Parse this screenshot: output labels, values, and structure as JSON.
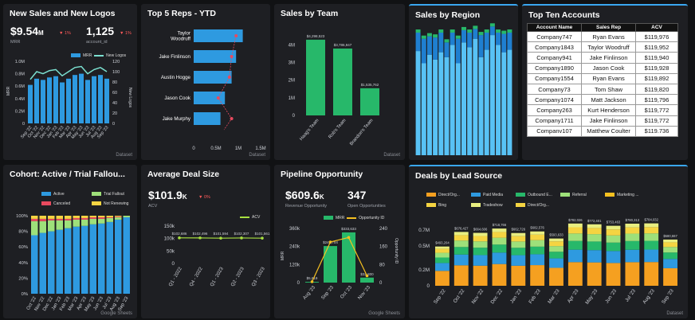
{
  "panels": {
    "new_sales": {
      "title": "New Sales and New Logos",
      "kpi1": "$9.54",
      "kpi1_unit": "M",
      "kpi1_delta": "▼ 1%",
      "kpi1_sub": "MRR",
      "kpi2": "1,125",
      "kpi2_delta": "▼ 1%",
      "kpi2_sub": "account_id",
      "legend": [
        "MRR",
        "New Logos"
      ],
      "source": "Dataset"
    },
    "top_reps": {
      "title": "Top 5 Reps - YTD",
      "source": "Dataset"
    },
    "sales_team": {
      "title": "Sales by Team",
      "source": "Dataset"
    },
    "sales_region": {
      "title": "Sales by Region"
    },
    "top_accounts": {
      "title": "Top Ten Accounts",
      "headers": [
        "Account Name",
        "Sales Rep",
        "ACV"
      ],
      "rows": [
        [
          "Company747",
          "Ryan Evans",
          "$119,976"
        ],
        [
          "Company1843",
          "Taylor Woodruff",
          "$119,952"
        ],
        [
          "Company941",
          "Jake Finlinson",
          "$119,940"
        ],
        [
          "Company1890",
          "Jason Cook",
          "$119,928"
        ],
        [
          "Company1554",
          "Ryan Evans",
          "$119,892"
        ],
        [
          "Company73",
          "Tom Shaw",
          "$119,820"
        ],
        [
          "Company1074",
          "Matt Jackson",
          "$119,796"
        ],
        [
          "Company263",
          "Kurt Henderson",
          "$119,772"
        ],
        [
          "Company1711",
          "Jake Finlinson",
          "$119,772"
        ],
        [
          "Companv107",
          "Matthew Coulter",
          "$119.736"
        ]
      ]
    },
    "cohort": {
      "title": "Cohort: Active / Trial Fallou...",
      "legend": [
        "Active",
        "Trial Fallout",
        "Canceled",
        "Not Renewing"
      ],
      "source": "Google Sheets"
    },
    "deal_size": {
      "title": "Average Deal Size",
      "kpi": "$101.9",
      "kpi_unit": "K",
      "kpi_delta": "▼ 0%",
      "kpi_sub": "ACV",
      "legend": [
        "ACV"
      ]
    },
    "pipeline": {
      "title": "Pipeline Opportunity",
      "kpi1": "$609.6",
      "kpi1_unit": "K",
      "kpi1_sub": "Revenue Opportunity",
      "kpi2": "347",
      "kpi2_sub": "Open Opportunities",
      "legend": [
        "MRR",
        "Opportunity ID"
      ],
      "source": "Google Sheets"
    },
    "lead_source": {
      "title": "Deals by Lead Source",
      "legend": [
        "Direct/Org...",
        "Paid Media",
        "Outbound E...",
        "Referral",
        "Marketing ...",
        "Bing",
        "Tradeshow",
        "Direct/Org..."
      ],
      "source": "Dataset"
    }
  },
  "colors": {
    "blue": "#2e9ae0",
    "lightblue": "#58c2f5",
    "green": "#27b86a",
    "lightgreen": "#9ee07a",
    "yellow": "#f5d442",
    "orange": "#f5a020",
    "red": "#e84a5f",
    "lime": "#a8e040"
  },
  "chart_data": [
    {
      "type": "bar",
      "id": "new_sales",
      "categories": [
        "Sep '22",
        "Oct '22",
        "Nov '22",
        "Dec '22",
        "Jan '23",
        "Feb '23",
        "Mar '23",
        "Apr '23",
        "May '23",
        "Jun '23",
        "Jul '23",
        "Aug '23",
        "Sep '23"
      ],
      "series": [
        {
          "name": "MRR",
          "values": [
            0.62,
            0.72,
            0.7,
            0.74,
            0.76,
            0.66,
            0.72,
            0.78,
            0.8,
            0.7,
            0.76,
            0.78,
            0.72
          ]
        },
        {
          "name": "New Logos",
          "values": [
            85,
            100,
            96,
            102,
            104,
            92,
            100,
            108,
            110,
            96,
            104,
            108,
            100
          ]
        }
      ],
      "ylim": [
        0,
        1.0
      ],
      "y2lim": [
        0,
        120
      ],
      "ylabel": "MRR",
      "y2label": "New Logos",
      "yticks": [
        "0",
        "0.2M",
        "0.4M",
        "0.6M",
        "0.8M",
        "1.0M"
      ],
      "y2ticks": [
        "0",
        "20",
        "40",
        "60",
        "80",
        "100",
        "120"
      ]
    },
    {
      "type": "bar",
      "id": "top_reps",
      "categories": [
        "Taylor Woodruff",
        "Jake Finlinson",
        "Austin Hogge",
        "Jason Cook",
        "Jake Murphy"
      ],
      "values": [
        1.1,
        0.95,
        0.85,
        0.7,
        0.6
      ],
      "markers": [
        0.95,
        0.85,
        0.8,
        0.55,
        0.85
      ],
      "xticks": [
        "0",
        "0.5M",
        "1M",
        "1.5M"
      ],
      "xlim": [
        0,
        1.5
      ]
    },
    {
      "type": "bar",
      "id": "sales_team",
      "categories": [
        "Haag's Team",
        "Rob's Team",
        "Brandon's Team"
      ],
      "values": [
        4.29,
        3.79,
        1.54
      ],
      "labels": [
        "$4,298,523",
        "$3,786,947",
        "$1,535,762"
      ],
      "ylim": [
        0,
        4.6
      ],
      "yticks": [
        "0",
        "1M",
        "2M",
        "3M",
        "4M"
      ]
    },
    {
      "type": "bar",
      "id": "sales_region",
      "values": [
        [
          0.85,
          0.15
        ],
        [
          0.75,
          0.2
        ],
        [
          0.82,
          0.15
        ],
        [
          0.78,
          0.18
        ],
        [
          0.84,
          0.16
        ],
        [
          0.8,
          0.12
        ],
        [
          0.9,
          0.1
        ],
        [
          0.75,
          0.2
        ],
        [
          0.92,
          0.1
        ],
        [
          0.88,
          0.12
        ],
        [
          0.95,
          0.08
        ],
        [
          0.8,
          0.18
        ],
        [
          0.86,
          0.14
        ],
        [
          0.98,
          0.07
        ],
        [
          0.9,
          0.1
        ],
        [
          0.84,
          0.15
        ],
        [
          0.86,
          0.14
        ]
      ]
    },
    {
      "type": "bar",
      "id": "cohort",
      "categories": [
        "Oct '22",
        "Nov '22",
        "Dec '22",
        "Jan '23",
        "Feb '23",
        "Mar '23",
        "Apr '23",
        "May '23",
        "Jun '23",
        "Jul '23",
        "Aug '23",
        "Sep '23"
      ],
      "series": [
        {
          "name": "Active",
          "values": [
            75,
            78,
            80,
            82,
            84,
            86,
            87,
            89,
            90,
            92,
            95,
            98
          ]
        },
        {
          "name": "Trial Fallout",
          "values": [
            18,
            15,
            14,
            12,
            10,
            9,
            8,
            7,
            6,
            5,
            3,
            2
          ]
        },
        {
          "name": "Canceled",
          "values": [
            3,
            3,
            2,
            2,
            2,
            2,
            2,
            2,
            2,
            1,
            1,
            0
          ]
        },
        {
          "name": "Not Renewing",
          "values": [
            4,
            4,
            4,
            4,
            4,
            3,
            3,
            2,
            2,
            2,
            1,
            0
          ]
        }
      ],
      "yticks": [
        "0%",
        "20%",
        "40%",
        "60%",
        "80%",
        "100%"
      ]
    },
    {
      "type": "line",
      "id": "deal_size",
      "categories": [
        "Q1 - 2022",
        "Q4 - 2022",
        "Q1 - 2023",
        "Q2 - 2023",
        "Q3 - 2023"
      ],
      "values": [
        102.7,
        102.5,
        101.6,
        102.3,
        101.6
      ],
      "labels": [
        "$102,686",
        "$102,496",
        "$101,594",
        "$102,307",
        "$101,561"
      ],
      "ylim": [
        0,
        160
      ],
      "yticks": [
        "0",
        "50k",
        "100k",
        "150k"
      ]
    },
    {
      "type": "bar",
      "id": "pipeline",
      "categories": [
        "Aug '23",
        "Sep '23",
        "Oct '23",
        "Nov '23"
      ],
      "values": [
        5,
        243,
        334,
        33
      ],
      "labels": [
        "$5,619",
        "$242,704",
        "$333,633",
        "$32,800"
      ],
      "line": [
        4,
        180,
        200,
        30
      ],
      "ylim": [
        0,
        360
      ],
      "yticks": [
        "0",
        "120k",
        "240k",
        "360k"
      ],
      "y2ticks": [
        "0",
        "80",
        "160",
        "240"
      ],
      "ylabel": "MRR",
      "y2label": "Opportunity ID"
    },
    {
      "type": "bar",
      "id": "lead_source",
      "categories": [
        "Sep '22",
        "Oct '22",
        "Nov '22",
        "Dec '22",
        "Jan '23",
        "Feb '23",
        "Mar '23",
        "Apr '23",
        "May '23",
        "Jun '23",
        "Jul '23",
        "Aug '23",
        "Sep '23"
      ],
      "totals": [
        493.2,
        676.4,
        664.6,
        718.8,
        662.7,
        682.6,
        593.6,
        782.0,
        772.4,
        753.5,
        780.3,
        784.0,
        580.7
      ],
      "labels": [
        "$493,204",
        "$676,427",
        "$664,606",
        "$718,766",
        "$662,726",
        "$682,576",
        "$593,633",
        "$782,026",
        "$772,401",
        "$753,463",
        "$780,313",
        "$784,032",
        "$580,667"
      ],
      "yticks": [
        "0",
        "0.2M",
        "0.5M",
        "0.7M"
      ]
    }
  ]
}
